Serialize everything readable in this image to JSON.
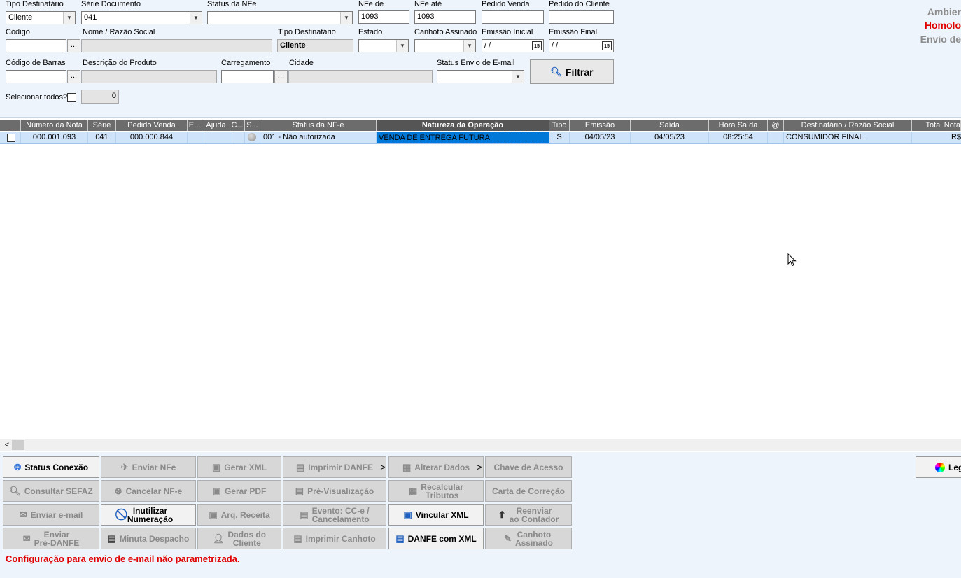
{
  "env": {
    "line1": "Ambier",
    "line2": "Homolo",
    "line3": "Envio de"
  },
  "filters": {
    "tipo_dest_label": "Tipo Destinatário",
    "tipo_dest_value": "Cliente",
    "serie_label": "Série Documento",
    "serie_value": "041",
    "status_nfe_label": "Status da NFe",
    "status_nfe_value": "",
    "nfe_de_label": "NFe de",
    "nfe_de_value": "1093",
    "nfe_ate_label": "NFe até",
    "nfe_ate_value": "1093",
    "pedido_venda_label": "Pedido Venda",
    "pedido_venda_value": "",
    "pedido_cliente_label": "Pedido do Cliente",
    "pedido_cliente_value": "",
    "codigo_label": "Código",
    "codigo_value": "",
    "nome_label": "Nome / Razão Social",
    "nome_value": "",
    "tipo_dest2_label": "Tipo Destinatário",
    "tipo_dest2_value": "Cliente",
    "estado_label": "Estado",
    "estado_value": "",
    "canhoto_label": "Canhoto Assinado",
    "canhoto_value": "",
    "emissao_ini_label": "Emissão Inicial",
    "emissao_ini_value": " / /",
    "emissao_fim_label": "Emissão Final",
    "emissao_fim_value": " / /",
    "cod_barras_label": "Código de Barras",
    "cod_barras_value": "",
    "descricao_label": "Descrição do Produto",
    "descricao_value": "",
    "carregamento_label": "Carregamento",
    "carregamento_value": "",
    "cidade_label": "Cidade",
    "cidade_value": "",
    "status_email_label": "Status Envio de E-mail",
    "status_email_value": "",
    "filtrar_label": "Filtrar",
    "selecionar_label": "Selecionar todos?",
    "selecionados_count": "0",
    "ellipsis": "...",
    "cal_label": "15"
  },
  "grid": {
    "columns": [
      "Número da Nota",
      "Série",
      "Pedido Venda",
      "E...",
      "Ajuda",
      "C...",
      "S...",
      "Status da NF-e",
      "Natureza da Operação",
      "Tipo",
      "Emissão",
      "Saída",
      "Hora Saída",
      "@",
      "Destinatário / Razão Social",
      "Total Nota"
    ],
    "row": {
      "numero": "000.001.093",
      "serie": "041",
      "pedido": "000.000.844",
      "status": "001 - Não autorizada",
      "natureza": "VENDA DE ENTREGA FUTURA",
      "tipo": "S",
      "emissao": "04/05/23",
      "saida": "04/05/23",
      "hora": "08:25:54",
      "destinatario": "CONSUMIDOR FINAL",
      "total": "R$"
    }
  },
  "scroll_left": "<",
  "buttons": {
    "status_conexao": "Status Conexão",
    "enviar_nfe": "Enviar NFe",
    "gerar_xml": "Gerar XML",
    "imprimir_danfe": "Imprimir DANFE",
    "alterar_dados": "Alterar Dados",
    "chave_acesso": "Chave de Acesso",
    "consultar_sefaz": "Consultar SEFAZ",
    "cancelar_nfe": "Cancelar NF-e",
    "gerar_pdf": "Gerar PDF",
    "pre_visualizacao": "Pré-Visualização",
    "recalcular_1": "Recalcular",
    "recalcular_2": "Tributos",
    "carta_correcao": "Carta de Correção",
    "enviar_email": "Enviar e-mail",
    "inutilizar_1": "Inutilizar",
    "inutilizar_2": "Numeração",
    "arq_receita": "Arq. Receita",
    "evento_1": "Evento: CC-e /",
    "evento_2": "Cancelamento",
    "vincular_xml": "Vincular XML",
    "reenviar_1": "Reenviar",
    "reenviar_2": "ao Contador",
    "enviar_pre_1": "Enviar",
    "enviar_pre_2": "Pré-DANFE",
    "minuta": "Minuta Despacho",
    "dados_cliente_1": "Dados do",
    "dados_cliente_2": "Cliente",
    "imprimir_canhoto": "Imprimir Canhoto",
    "danfe_xml": "DANFE com XML",
    "canhoto_ass_1": "Canhoto",
    "canhoto_ass_2": "Assinado",
    "legenda": "Leg",
    "more": ">"
  },
  "status_message": "Configuração para envio de e-mail não parametrizada."
}
